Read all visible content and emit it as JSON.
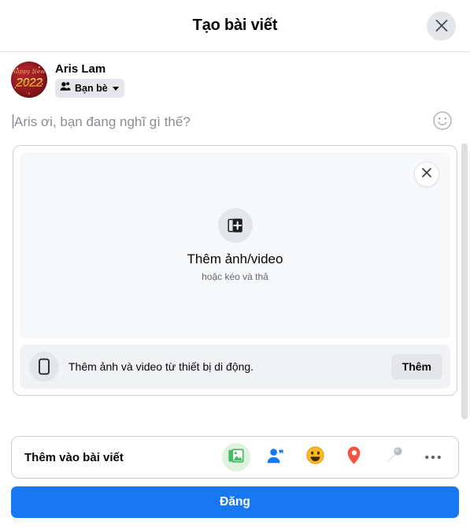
{
  "header": {
    "title": "Tạo bài viết",
    "close_icon": "close-icon"
  },
  "author": {
    "name": "Aris Lam",
    "avatar": {
      "greeting": "Happy New Year",
      "year": "2022",
      "icon": "avatar"
    },
    "privacy": {
      "label": "Bạn bè",
      "icon": "friends-icon",
      "chevron_icon": "chevron-down-icon"
    }
  },
  "composer": {
    "placeholder": "Aris ơi, bạn đang nghĩ gì thế?",
    "emoji_icon": "emoji-smiley-icon"
  },
  "media": {
    "dropzone": {
      "title": "Thêm ảnh/video",
      "subtitle": "hoặc kéo và thả",
      "icon": "add-photo-video-icon",
      "close_icon": "close-icon"
    },
    "mobile": {
      "text": "Thêm ảnh và video từ thiết bị di động.",
      "button_label": "Thêm",
      "icon": "mobile-phone-icon"
    }
  },
  "add_to_post": {
    "label": "Thêm vào bài viết",
    "items": [
      {
        "name": "photo-video-icon",
        "title": "Ảnh/video",
        "active": true
      },
      {
        "name": "tag-people-icon",
        "title": "Gắn thẻ bạn bè",
        "active": false
      },
      {
        "name": "feeling-activity-icon",
        "title": "Cảm xúc/hoạt động",
        "active": false
      },
      {
        "name": "location-pin-icon",
        "title": "Check in",
        "active": false
      },
      {
        "name": "microphone-icon",
        "title": "Video trực tiếp",
        "active": false
      },
      {
        "name": "more-options-icon",
        "title": "Xem thêm",
        "active": false
      }
    ]
  },
  "submit": {
    "label": "Đăng"
  },
  "colors": {
    "brand_blue": "#1877f2",
    "photo_green": "#45bd62",
    "tag_blue": "#1877f2",
    "feeling_yellow": "#f7b928",
    "location_red": "#f5533d",
    "mic_gray": "#9aa0a6",
    "text_primary": "#050505",
    "text_secondary": "#65676b",
    "surface": "#f0f2f5"
  }
}
